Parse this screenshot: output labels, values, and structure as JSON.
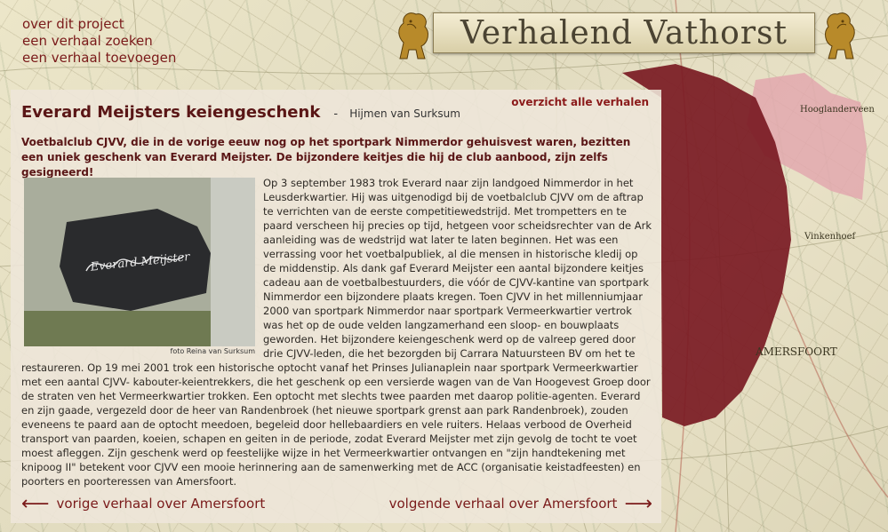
{
  "top_nav": {
    "items": [
      "over dit project",
      "een verhaal zoeken",
      "een verhaal toevoegen"
    ]
  },
  "banner": {
    "title": "Verhalend Vathorst"
  },
  "map": {
    "labels": [
      "Hooglanderveen",
      "Vinkenhoef",
      "AMERSFOORT"
    ],
    "colors": {
      "region_dark": "#7a1a23",
      "region_light": "#e2a8ae"
    }
  },
  "story": {
    "title": "Everard Meijsters keiengeschenk",
    "separator": "-",
    "author": "Hijmen van Surksum",
    "overview_link": "overzicht alle verhalen",
    "intro": "Voetbalclub CJVV, die in de vorige eeuw nog op het sportpark Nimmerdor gehuisvest waren, bezitten een uniek geschenk van Everard Meijster. De bijzondere keitjes die hij de club aanbood, zijn zelfs gesigneerd!",
    "photo_signature": "Everard Meijster",
    "photo_caption": "foto Reina van Surksum",
    "body": "Op 3 september 1983 trok Everard naar zijn landgoed Nimmerdor in het Leusderkwartier. Hij was uitgenodigd bij de voetbalclub CJVV om de aftrap te verrichten van de eerste competitiewedstrijd. Met trompetters en te paard verscheen hij precies op tijd, hetgeen voor scheidsrechter van de Ark aanleiding was de wedstrijd wat later te laten beginnen. Het was een verrassing voor het voetbalpubliek, al die mensen in historische kledij op de middenstip. Als dank gaf Everard Meijster een aantal bijzondere keitjes cadeau aan de voetbalbestuurders, die vóór de CJVV-kantine van sportpark Nimmerdor een bijzondere plaats kregen. Toen CJVV in het millenniumjaar 2000 van sportpark Nimmerdor naar sportpark Vermeerkwartier vertrok was het op de oude velden langzamerhand een sloop- en bouwplaats geworden. Het bijzondere keiengeschenk werd op de valreep gered door drie CJVV-leden, die het bezorgden bij Carrara Natuursteen BV om het te restaureren. Op 19 mei 2001 trok een historische optocht vanaf het Prinses Julianaplein naar sportpark Vermeerkwartier met een aantal CJVV- kabouter-keientrekkers, die het geschenk op een versierde wagen van de Van Hoogevest Groep door de straten ven het Vermeerkwartier trokken. Een optocht met slechts twee paarden met daarop politie-agenten. Everard en zijn gaade, vergezeld door de heer van Randenbroek (het nieuwe sportpark grenst aan park Randenbroek), zouden eveneens te paard  aan de optocht meedoen, begeleid door  hellebaardiers en vele ruiters. Helaas verbood de Overheid transport van paarden, koeien, schapen en geiten in de periode, zodat Everard Meijster met zijn gevolg de tocht te voet moest afleggen.  Zijn geschenk werd op feestelijke wijze in het Vermeerkwartier ontvangen en \"zijn handtekening met knipoog II\" betekent voor CJVV een mooie herinnering aan de samenwerking met de ACC (organisatie keistadfeesten) en poorters en poorteressen van Amersfoort.",
    "prev_link": "vorige verhaal over Amersfoort",
    "next_link": "volgende verhaal over Amersfoort",
    "prev_arrow": "⟵",
    "next_arrow": "⟶"
  }
}
